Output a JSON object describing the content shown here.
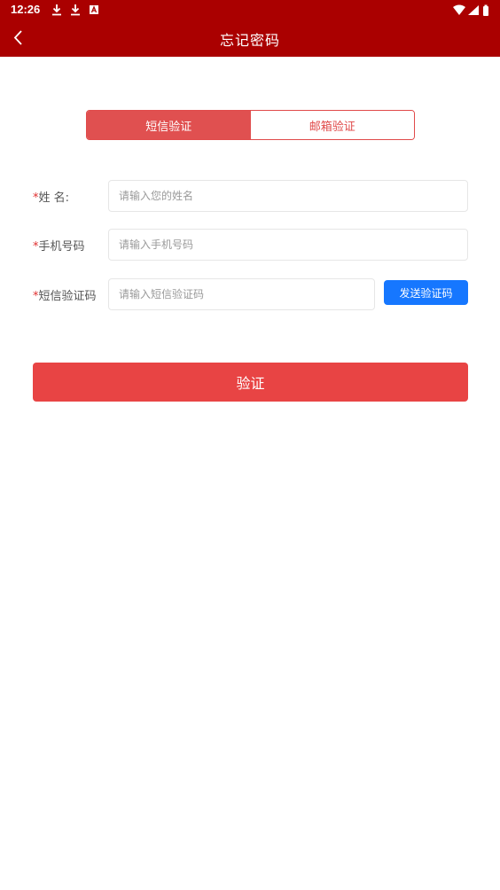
{
  "status_bar": {
    "time": "12:26",
    "icons_left": [
      "download-icon",
      "download-icon",
      "a-badge-icon"
    ],
    "icons_right": [
      "wifi-icon",
      "signal-icon",
      "battery-icon"
    ]
  },
  "app_bar": {
    "title": "忘记密码",
    "back_icon": "chevron-left-icon",
    "background": "#aa0000"
  },
  "tabs": [
    {
      "label": "短信验证",
      "active": true
    },
    {
      "label": "邮箱验证",
      "active": false
    }
  ],
  "form": {
    "name": {
      "required_mark": "*",
      "label": "姓 名:",
      "placeholder": "请输入您的姓名"
    },
    "phone": {
      "required_mark": "*",
      "label": "手机号码",
      "placeholder": "请输入手机号码"
    },
    "sms_code": {
      "required_mark": "*",
      "label": "短信验证码",
      "placeholder": "请输入短信验证码"
    }
  },
  "send_code_button": "发送验证码",
  "verify_button": "验证",
  "colors": {
    "brand": "#aa0000",
    "tab_active": "#e05050",
    "primary_button": "#e84444",
    "send_code_button": "#1677ff",
    "required": "#e03030"
  }
}
